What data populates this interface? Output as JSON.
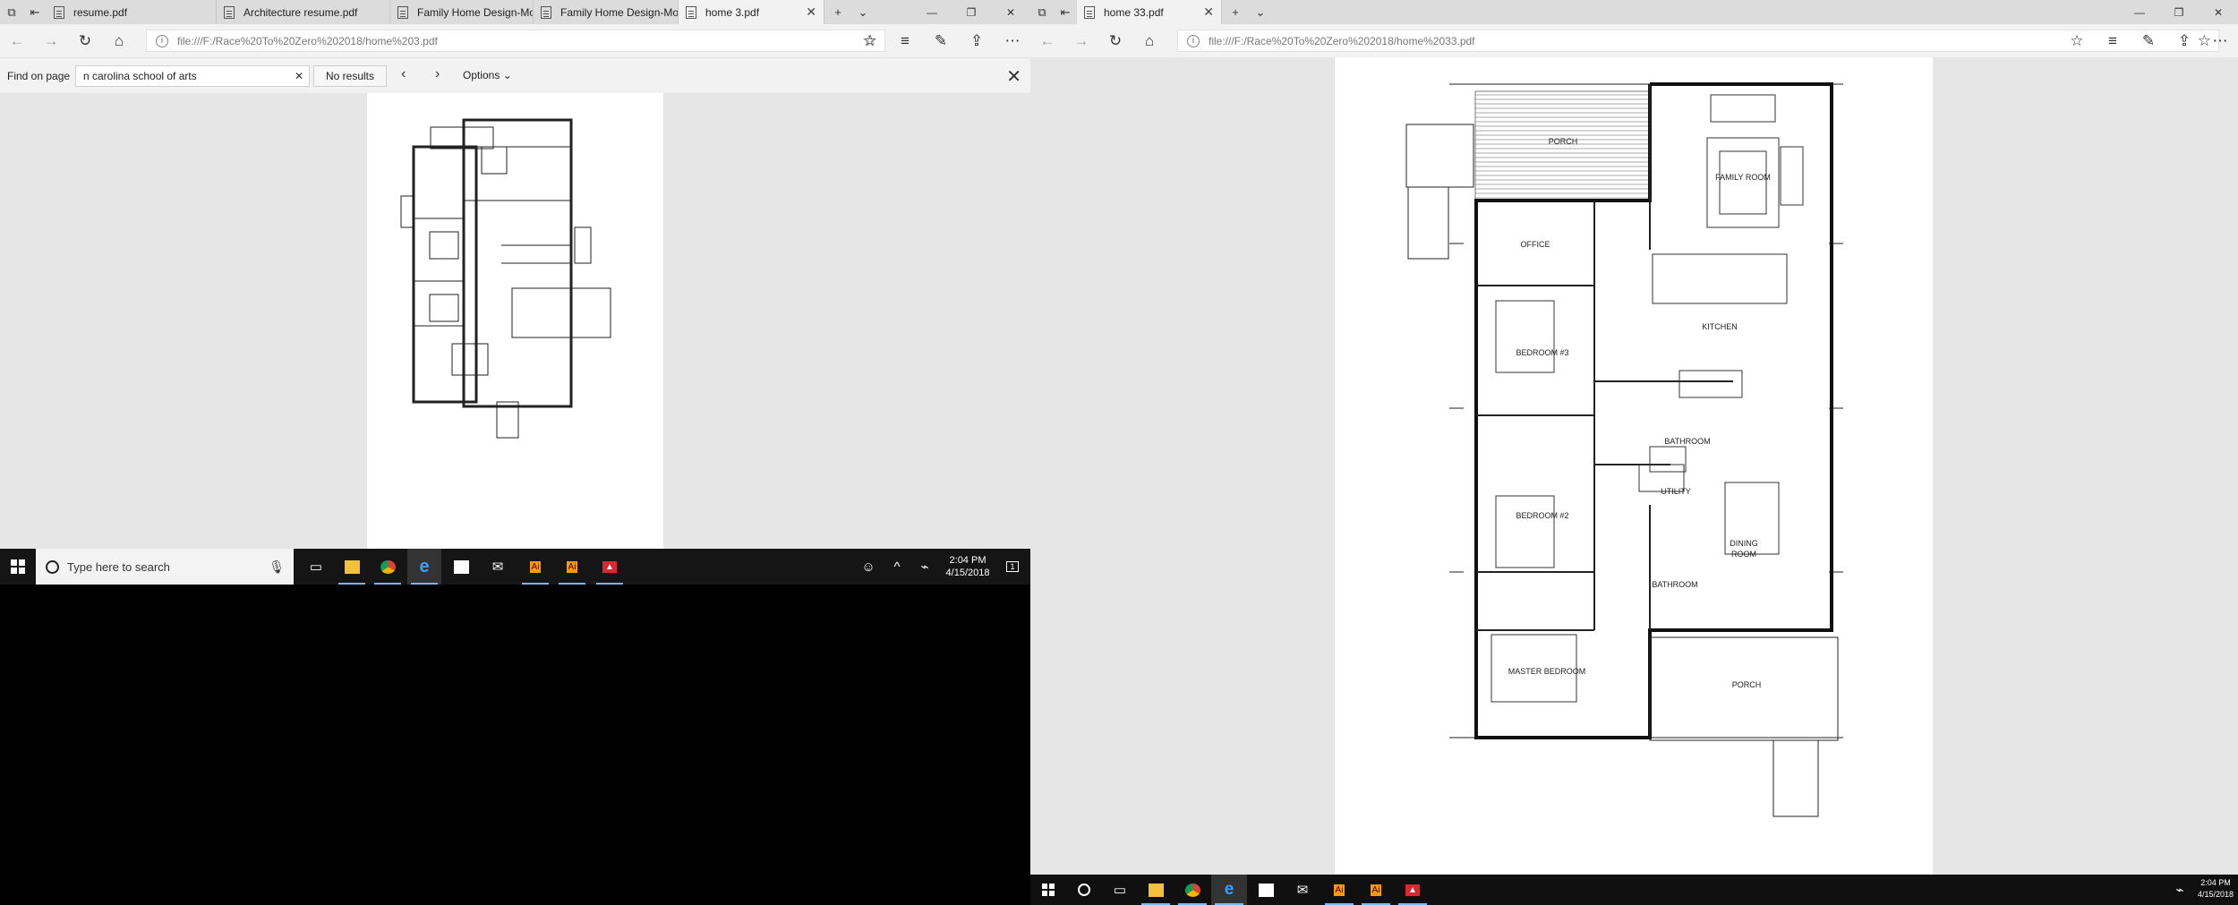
{
  "left_window": {
    "tabs": [
      {
        "label": "resume.pdf",
        "active": false
      },
      {
        "label": "Architecture resume.pdf",
        "active": false
      },
      {
        "label": "Family Home Design-Mode",
        "active": false
      },
      {
        "label": "Family Home Design-Mode",
        "active": false
      },
      {
        "label": "home 3.pdf",
        "active": true
      }
    ],
    "address": "file:///F:/Race%20To%20Zero%202018/home%203.pdf",
    "find": {
      "label": "Find on page",
      "query": "n carolina school of arts",
      "result": "No results",
      "options_label": "Options"
    }
  },
  "right_window": {
    "tabs": [
      {
        "label": "home 33.pdf",
        "active": true
      }
    ],
    "address": "file:///F:/Race%20To%20Zero%202018/home%2033.pdf"
  },
  "floor_plan": {
    "rooms": {
      "porch_top": "PORCH",
      "family_room": "FAMILY ROOM",
      "office": "OFFICE",
      "kitchen": "KITCHEN",
      "bedroom3": "BEDROOM #3",
      "bathroom1": "BATHROOM",
      "utility": "UTILITY",
      "bedroom2": "BEDROOM #2",
      "dining_line1": "DINING",
      "dining_line2": "ROOM",
      "bathroom2": "BATHROOM",
      "master_bedroom": "MASTER BEDROOM",
      "porch_bottom": "PORCH"
    }
  },
  "taskbar_left": {
    "search_placeholder": "Type here to search",
    "time": "2:04 PM",
    "date": "4/15/2018",
    "notification_count": "1"
  },
  "taskbar_right": {
    "time": "2:04 PM",
    "date": "4/15/2018"
  },
  "icons": {
    "pdf_tab": "pdf-icon",
    "back": "back-arrow-icon",
    "forward": "forward-arrow-icon",
    "refresh": "refresh-icon",
    "home": "home-icon",
    "favorite": "star-icon"
  },
  "colors": {
    "taskbar": "#151515",
    "tab_bar": "#dcdcdc",
    "active_tab": "#f2f2f2",
    "pdf_background": "#e6e6e6",
    "acrobat_red": "#d9282f",
    "illustrator_orange": "#ff9a00"
  }
}
